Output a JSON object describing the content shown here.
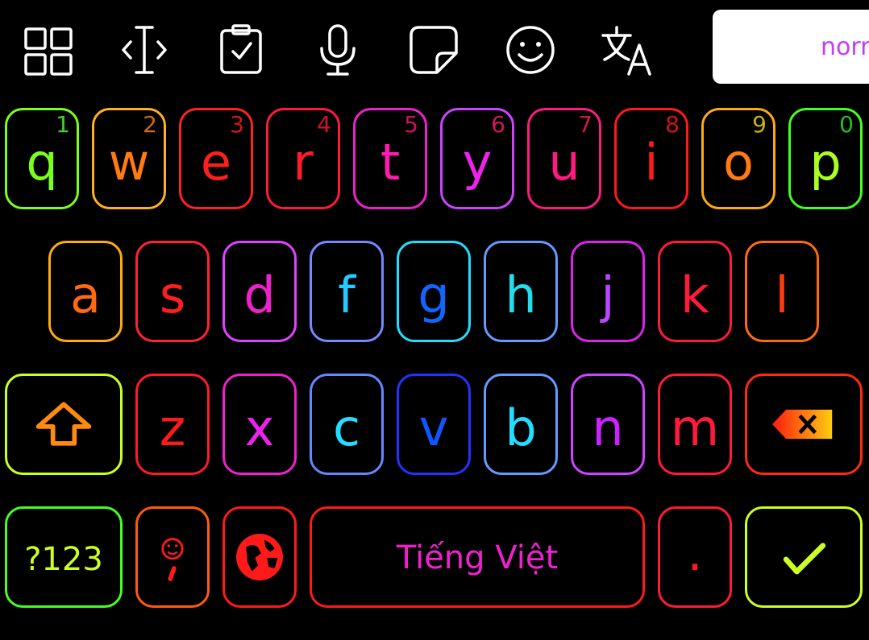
{
  "toolbar": {
    "items": [
      {
        "icon": "grid-icon"
      },
      {
        "icon": "text-cursor-icon"
      },
      {
        "icon": "clipboard-icon"
      },
      {
        "icon": "microphone-icon"
      },
      {
        "icon": "sticker-icon"
      },
      {
        "icon": "emoji-icon"
      },
      {
        "icon": "translate-icon"
      }
    ],
    "icon_color": "#ffffff",
    "prediction_text": "norr"
  },
  "rows": [
    [
      {
        "letter": "q",
        "num": "1",
        "letter_color": "#7aff1a",
        "num_color": "#3fd12a",
        "border": "#7aff1a"
      },
      {
        "letter": "w",
        "num": "2",
        "letter_color": "#ff7a10",
        "num_color": "#d06a10",
        "border": "#ffb020"
      },
      {
        "letter": "e",
        "num": "3",
        "letter_color": "#ff1e1e",
        "num_color": "#cc1a1a",
        "border": "#ff2222"
      },
      {
        "letter": "r",
        "num": "4",
        "letter_color": "#ff1a2a",
        "num_color": "#cc1525",
        "border": "#ff1a3a"
      },
      {
        "letter": "t",
        "num": "5",
        "letter_color": "#ff1ab0",
        "num_color": "#cc1060",
        "border": "#ee22cc"
      },
      {
        "letter": "y",
        "num": "6",
        "letter_color": "#ee22ee",
        "num_color": "#cc1a5a",
        "border": "#cc44ff"
      },
      {
        "letter": "u",
        "num": "7",
        "letter_color": "#ff1a80",
        "num_color": "#cc1a40",
        "border": "#ff1a80"
      },
      {
        "letter": "i",
        "num": "8",
        "letter_color": "#ff1a1a",
        "num_color": "#cc1515",
        "border": "#ff1a1a"
      },
      {
        "letter": "o",
        "num": "9",
        "letter_color": "#ff7a10",
        "num_color": "#c8b410",
        "border": "#ffaa10"
      },
      {
        "letter": "p",
        "num": "0",
        "letter_color": "#aaff20",
        "num_color": "#20c020",
        "border": "#44ff22"
      }
    ],
    [
      {
        "letter": "a",
        "letter_color": "#ff6a10",
        "border": "#ffaa10"
      },
      {
        "letter": "s",
        "letter_color": "#ff1e1e",
        "border": "#ff2233"
      },
      {
        "letter": "d",
        "letter_color": "#ee22cc",
        "border": "#dd44ff"
      },
      {
        "letter": "f",
        "letter_color": "#22ccff",
        "border": "#7788ff"
      },
      {
        "letter": "g",
        "letter_color": "#1166ff",
        "border": "#22ddff"
      },
      {
        "letter": "h",
        "letter_color": "#22ddee",
        "border": "#6699ff"
      },
      {
        "letter": "j",
        "letter_color": "#bb44ff",
        "border": "#dd22ee"
      },
      {
        "letter": "k",
        "letter_color": "#ff1a3a",
        "border": "#ff1a3a"
      },
      {
        "letter": "l",
        "letter_color": "#ff3a10",
        "border": "#ff6a10"
      }
    ],
    [
      {
        "letter": "z",
        "letter_color": "#ff1a1a",
        "border": "#ff1a2a"
      },
      {
        "letter": "x",
        "letter_color": "#ee22ee",
        "border": "#ee22cc"
      },
      {
        "letter": "c",
        "letter_color": "#22ddff",
        "border": "#6688ff"
      },
      {
        "letter": "v",
        "letter_color": "#1155ff",
        "border": "#2233ff"
      },
      {
        "letter": "b",
        "letter_color": "#22ddff",
        "border": "#6699ff"
      },
      {
        "letter": "n",
        "letter_color": "#cc22ff",
        "border": "#cc44ff"
      },
      {
        "letter": "m",
        "letter_color": "#ff1a3a",
        "border": "#ff1a3a"
      }
    ]
  ],
  "shift_key": {
    "icon": "shift-arrow-icon",
    "border": "#ccff22",
    "color": "#ff8a10"
  },
  "backspace_key": {
    "icon": "backspace-icon",
    "border": "#ff2a10",
    "color": "#ff8a10"
  },
  "bottom_row": {
    "symbols_label": "?123",
    "symbols_color": "#ccff22",
    "symbols_border": "#44ff22",
    "emoji_comma": {
      "icon": "emoji-comma-icon",
      "border": "#ff5a10",
      "color": "#ff1a1a"
    },
    "globe": {
      "icon": "globe-icon",
      "border": "#ff1a1a",
      "color": "#ff1a1a"
    },
    "space_label": "Tiếng Việt",
    "space_color": "#ee22cc",
    "space_border": "#ff1a1a",
    "period_label": ".",
    "period_color": "#ff1a1a",
    "period_border": "#ff1a3a",
    "enter": {
      "icon": "checkmark-icon",
      "border": "#ccff22",
      "color": "#ccff22"
    }
  }
}
